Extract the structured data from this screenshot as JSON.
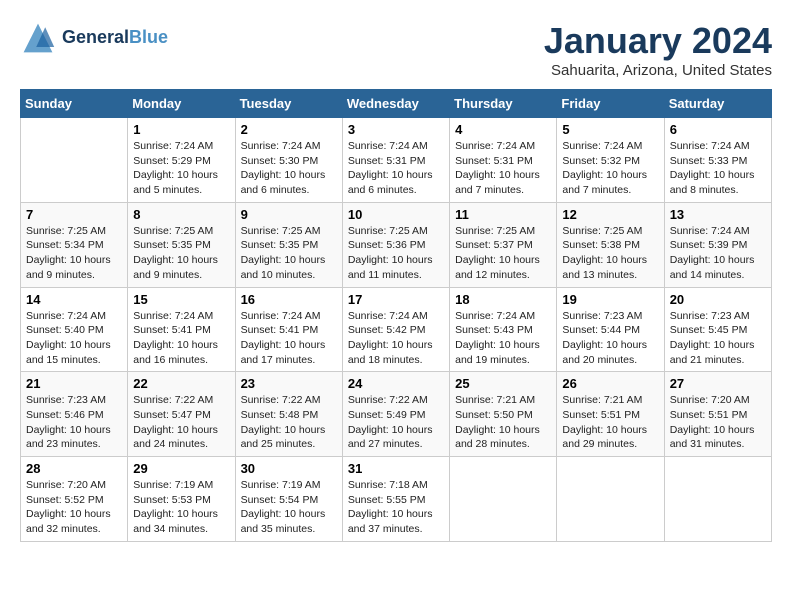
{
  "header": {
    "logo_line1": "General",
    "logo_line2": "Blue",
    "month": "January 2024",
    "location": "Sahuarita, Arizona, United States"
  },
  "days_of_week": [
    "Sunday",
    "Monday",
    "Tuesday",
    "Wednesday",
    "Thursday",
    "Friday",
    "Saturday"
  ],
  "weeks": [
    [
      {
        "day": "",
        "sunrise": "",
        "sunset": "",
        "daylight": ""
      },
      {
        "day": "1",
        "sunrise": "Sunrise: 7:24 AM",
        "sunset": "Sunset: 5:29 PM",
        "daylight": "Daylight: 10 hours and 5 minutes."
      },
      {
        "day": "2",
        "sunrise": "Sunrise: 7:24 AM",
        "sunset": "Sunset: 5:30 PM",
        "daylight": "Daylight: 10 hours and 6 minutes."
      },
      {
        "day": "3",
        "sunrise": "Sunrise: 7:24 AM",
        "sunset": "Sunset: 5:31 PM",
        "daylight": "Daylight: 10 hours and 6 minutes."
      },
      {
        "day": "4",
        "sunrise": "Sunrise: 7:24 AM",
        "sunset": "Sunset: 5:31 PM",
        "daylight": "Daylight: 10 hours and 7 minutes."
      },
      {
        "day": "5",
        "sunrise": "Sunrise: 7:24 AM",
        "sunset": "Sunset: 5:32 PM",
        "daylight": "Daylight: 10 hours and 7 minutes."
      },
      {
        "day": "6",
        "sunrise": "Sunrise: 7:24 AM",
        "sunset": "Sunset: 5:33 PM",
        "daylight": "Daylight: 10 hours and 8 minutes."
      }
    ],
    [
      {
        "day": "7",
        "sunrise": "Sunrise: 7:25 AM",
        "sunset": "Sunset: 5:34 PM",
        "daylight": "Daylight: 10 hours and 9 minutes."
      },
      {
        "day": "8",
        "sunrise": "Sunrise: 7:25 AM",
        "sunset": "Sunset: 5:35 PM",
        "daylight": "Daylight: 10 hours and 9 minutes."
      },
      {
        "day": "9",
        "sunrise": "Sunrise: 7:25 AM",
        "sunset": "Sunset: 5:35 PM",
        "daylight": "Daylight: 10 hours and 10 minutes."
      },
      {
        "day": "10",
        "sunrise": "Sunrise: 7:25 AM",
        "sunset": "Sunset: 5:36 PM",
        "daylight": "Daylight: 10 hours and 11 minutes."
      },
      {
        "day": "11",
        "sunrise": "Sunrise: 7:25 AM",
        "sunset": "Sunset: 5:37 PM",
        "daylight": "Daylight: 10 hours and 12 minutes."
      },
      {
        "day": "12",
        "sunrise": "Sunrise: 7:25 AM",
        "sunset": "Sunset: 5:38 PM",
        "daylight": "Daylight: 10 hours and 13 minutes."
      },
      {
        "day": "13",
        "sunrise": "Sunrise: 7:24 AM",
        "sunset": "Sunset: 5:39 PM",
        "daylight": "Daylight: 10 hours and 14 minutes."
      }
    ],
    [
      {
        "day": "14",
        "sunrise": "Sunrise: 7:24 AM",
        "sunset": "Sunset: 5:40 PM",
        "daylight": "Daylight: 10 hours and 15 minutes."
      },
      {
        "day": "15",
        "sunrise": "Sunrise: 7:24 AM",
        "sunset": "Sunset: 5:41 PM",
        "daylight": "Daylight: 10 hours and 16 minutes."
      },
      {
        "day": "16",
        "sunrise": "Sunrise: 7:24 AM",
        "sunset": "Sunset: 5:41 PM",
        "daylight": "Daylight: 10 hours and 17 minutes."
      },
      {
        "day": "17",
        "sunrise": "Sunrise: 7:24 AM",
        "sunset": "Sunset: 5:42 PM",
        "daylight": "Daylight: 10 hours and 18 minutes."
      },
      {
        "day": "18",
        "sunrise": "Sunrise: 7:24 AM",
        "sunset": "Sunset: 5:43 PM",
        "daylight": "Daylight: 10 hours and 19 minutes."
      },
      {
        "day": "19",
        "sunrise": "Sunrise: 7:23 AM",
        "sunset": "Sunset: 5:44 PM",
        "daylight": "Daylight: 10 hours and 20 minutes."
      },
      {
        "day": "20",
        "sunrise": "Sunrise: 7:23 AM",
        "sunset": "Sunset: 5:45 PM",
        "daylight": "Daylight: 10 hours and 21 minutes."
      }
    ],
    [
      {
        "day": "21",
        "sunrise": "Sunrise: 7:23 AM",
        "sunset": "Sunset: 5:46 PM",
        "daylight": "Daylight: 10 hours and 23 minutes."
      },
      {
        "day": "22",
        "sunrise": "Sunrise: 7:22 AM",
        "sunset": "Sunset: 5:47 PM",
        "daylight": "Daylight: 10 hours and 24 minutes."
      },
      {
        "day": "23",
        "sunrise": "Sunrise: 7:22 AM",
        "sunset": "Sunset: 5:48 PM",
        "daylight": "Daylight: 10 hours and 25 minutes."
      },
      {
        "day": "24",
        "sunrise": "Sunrise: 7:22 AM",
        "sunset": "Sunset: 5:49 PM",
        "daylight": "Daylight: 10 hours and 27 minutes."
      },
      {
        "day": "25",
        "sunrise": "Sunrise: 7:21 AM",
        "sunset": "Sunset: 5:50 PM",
        "daylight": "Daylight: 10 hours and 28 minutes."
      },
      {
        "day": "26",
        "sunrise": "Sunrise: 7:21 AM",
        "sunset": "Sunset: 5:51 PM",
        "daylight": "Daylight: 10 hours and 29 minutes."
      },
      {
        "day": "27",
        "sunrise": "Sunrise: 7:20 AM",
        "sunset": "Sunset: 5:51 PM",
        "daylight": "Daylight: 10 hours and 31 minutes."
      }
    ],
    [
      {
        "day": "28",
        "sunrise": "Sunrise: 7:20 AM",
        "sunset": "Sunset: 5:52 PM",
        "daylight": "Daylight: 10 hours and 32 minutes."
      },
      {
        "day": "29",
        "sunrise": "Sunrise: 7:19 AM",
        "sunset": "Sunset: 5:53 PM",
        "daylight": "Daylight: 10 hours and 34 minutes."
      },
      {
        "day": "30",
        "sunrise": "Sunrise: 7:19 AM",
        "sunset": "Sunset: 5:54 PM",
        "daylight": "Daylight: 10 hours and 35 minutes."
      },
      {
        "day": "31",
        "sunrise": "Sunrise: 7:18 AM",
        "sunset": "Sunset: 5:55 PM",
        "daylight": "Daylight: 10 hours and 37 minutes."
      },
      {
        "day": "",
        "sunrise": "",
        "sunset": "",
        "daylight": ""
      },
      {
        "day": "",
        "sunrise": "",
        "sunset": "",
        "daylight": ""
      },
      {
        "day": "",
        "sunrise": "",
        "sunset": "",
        "daylight": ""
      }
    ]
  ]
}
